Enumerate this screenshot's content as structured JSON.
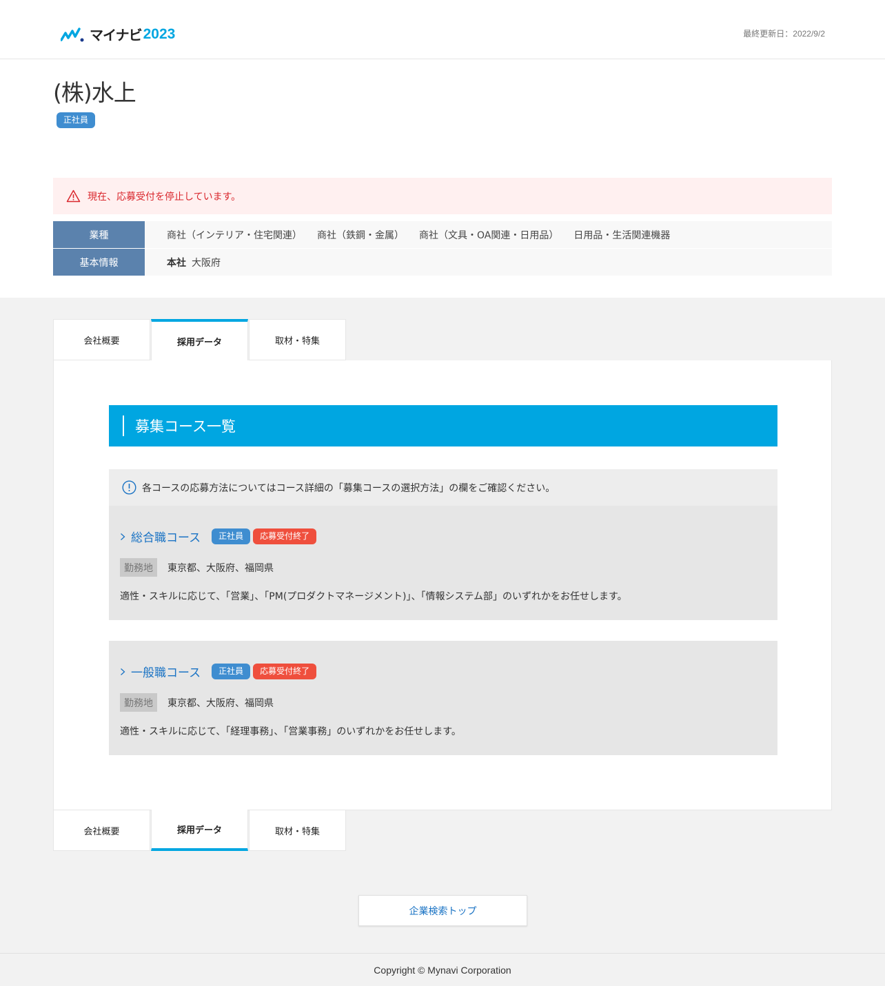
{
  "header": {
    "logo_brand": "マイナビ",
    "logo_year": "2023",
    "updated_label": "最終更新日：",
    "updated_date": "2022/9/2"
  },
  "company": {
    "name": "(株)水上",
    "employment_tag": "正社員"
  },
  "alert": {
    "text": "現在、応募受付を停止しています。"
  },
  "info": {
    "industry_label": "業種",
    "industries": [
      "商社（インテリア・住宅関連）",
      "商社（鉄鋼・金属）",
      "商社（文具・OA関連・日用品）",
      "日用品・生活関連機器"
    ],
    "basic_label": "基本情報",
    "hq_label": "本社",
    "hq_value": "大阪府"
  },
  "tabs": [
    {
      "label": "会社概要"
    },
    {
      "label": "採用データ"
    },
    {
      "label": "取材・特集"
    }
  ],
  "section": {
    "title": "募集コース一覧",
    "notice": "各コースの応募方法についてはコース詳細の「募集コースの選択方法」の欄をご確認ください。"
  },
  "courses": [
    {
      "title": "総合職コース",
      "tag_employment": "正社員",
      "tag_status": "応募受付終了",
      "location_label": "勤務地",
      "location": "東京都、大阪府、福岡県",
      "description": "適性・スキルに応じて、「営業」、「PM(プロダクトマネージメント)」、「情報システム部」のいずれかをお任せします。"
    },
    {
      "title": "一般職コース",
      "tag_employment": "正社員",
      "tag_status": "応募受付終了",
      "location_label": "勤務地",
      "location": "東京都、大阪府、福岡県",
      "description": "適性・スキルに応じて、「経理事務」、「営業事務」のいずれかをお任せします。"
    }
  ],
  "search_top_label": "企業検索トップ",
  "footer": {
    "copyright": "Copyright © Mynavi Corporation"
  },
  "colors": {
    "accent": "#00a6e1",
    "tag_blue": "#3f8dd0",
    "tag_red": "#ef4f3d",
    "alert_red": "#d9262c",
    "link_blue": "#1a73c4"
  }
}
